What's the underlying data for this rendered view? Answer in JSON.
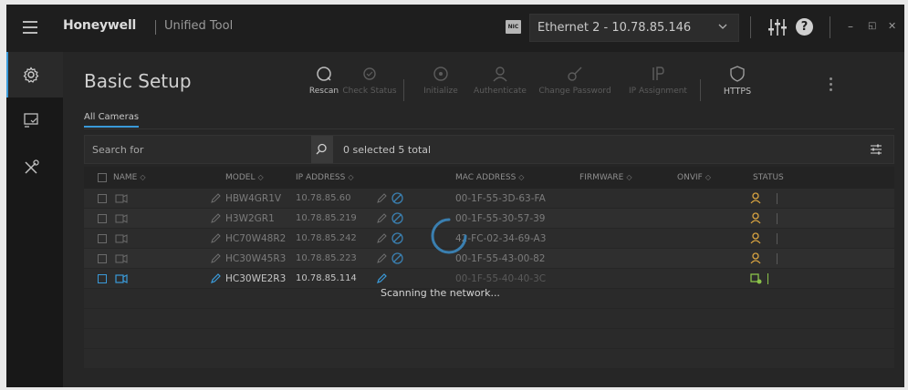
{
  "titlebar": {
    "brand": "Honeywell",
    "app_name": "Unified Tool",
    "nic_label": "NIC",
    "network_select": "Ethernet 2 - 10.78.85.146",
    "minimize": "–",
    "restore": "◱",
    "close": "✕",
    "help": "?"
  },
  "sidebar": {
    "items": [
      {
        "icon": "gear-icon",
        "active": true
      },
      {
        "icon": "device-scan-icon",
        "active": false
      },
      {
        "icon": "tools-icon",
        "active": false
      }
    ]
  },
  "page": {
    "title": "Basic Setup",
    "toolbar": [
      {
        "label": "Rescan",
        "icon": "rescan-icon",
        "enabled": true
      },
      {
        "label": "Check Status",
        "icon": "check-status-icon",
        "enabled": false
      },
      {
        "label": "Initialize",
        "icon": "initialize-icon",
        "enabled": false
      },
      {
        "label": "Authenticate",
        "icon": "authenticate-icon",
        "enabled": false
      },
      {
        "label": "Change Password",
        "icon": "change-password-icon",
        "enabled": false
      },
      {
        "label": "IP Assignment",
        "icon": "ip-assignment-icon",
        "enabled": false
      },
      {
        "label": "HTTPS",
        "icon": "shield-icon",
        "enabled": true
      }
    ],
    "tab": "All Cameras"
  },
  "search": {
    "placeholder": "Search for",
    "selection_summary": "0 selected 5 total"
  },
  "table": {
    "columns": [
      "NAME",
      "MODEL",
      "IP ADDRESS",
      "MAC ADDRESS",
      "FIRMWARE",
      "ONVIF",
      "STATUS"
    ],
    "rows": [
      {
        "model": "HBW4GR1V",
        "ip": "10.78.85.60",
        "mac": "00-1F-55-3D-63-FA",
        "status": "user-warning"
      },
      {
        "model": "H3W2GR1",
        "ip": "10.78.85.219",
        "mac": "00-1F-55-30-57-39",
        "status": "user-warning"
      },
      {
        "model": "HC70W48R2",
        "ip": "10.78.85.242",
        "mac": "42-FC-02-34-69-A3",
        "status": "user-warning"
      },
      {
        "model": "HC30W45R3",
        "ip": "10.78.85.223",
        "mac": "00-1F-55-43-00-82",
        "status": "user-warning"
      },
      {
        "model": "HC30WE2R3",
        "ip": "10.78.85.114",
        "mac": "00-1F-55-40-40-3C",
        "status": "online"
      }
    ]
  },
  "overlay": {
    "message": "Scanning the network..."
  },
  "colors": {
    "accent": "#3a9ad9",
    "warning": "#d9a441",
    "online": "#8bc34a"
  }
}
